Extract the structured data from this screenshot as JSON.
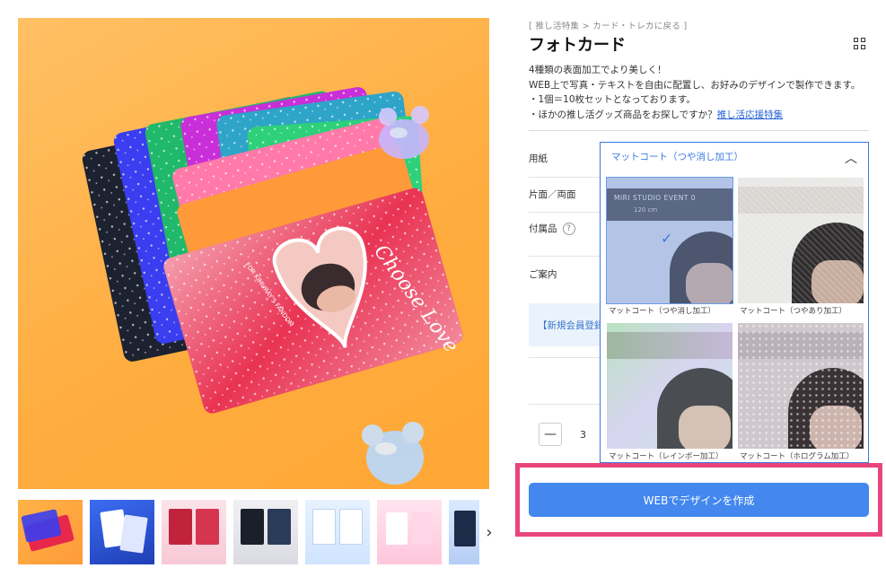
{
  "breadcrumb": "[ 推し活特集 > カード・トレカに戻る ]",
  "product": {
    "title": "フォトカード",
    "description": [
      "4種類の表面加工でより美しく！",
      "WEB上で写真・テキストを自由に配置し、お好みのデザインで製作できます。",
      "・1個＝10枚セットとなっております。"
    ],
    "promo_prefix": "・ほかの推し活グッズ商品をお探しですか？",
    "promo_link": "推し活応援特集"
  },
  "photo": {
    "card_brand_text": "Choose Love",
    "card_sub_text": "FOR KIMURAY'S FANDOM"
  },
  "options": {
    "paper_label": "用紙",
    "sides_label": "片面／両面",
    "accessories_label": "付属品",
    "help_glyph": "?",
    "info_label": "ご案内",
    "notice_text": "【新規会員登録",
    "selected_paper": "マットコート（つや消し加工）",
    "paper_choices": [
      {
        "label": "マットコート（つや消し加工）",
        "selected": true
      },
      {
        "label": "マットコート（つやあり加工）",
        "selected": false
      },
      {
        "label": "マットコート（レインボー加工）",
        "selected": false
      },
      {
        "label": "マットコート（ホログラム加工）",
        "selected": false
      }
    ],
    "swatch_overlay_text": "MIRI STUDIO EVENT 0",
    "swatch_overlay_size": "120 cm",
    "check_glyph": "✓",
    "chevron_glyph": "︿"
  },
  "quantity": {
    "minus_glyph": "—",
    "value": "3"
  },
  "cta": {
    "label": "WEBでデザインを作成"
  },
  "gallery": {
    "next_glyph": "›",
    "thumb_count": 7
  },
  "colors": {
    "accent": "#4387ef",
    "highlight_frame": "#e8457c",
    "background_photo": "#ffad40"
  }
}
